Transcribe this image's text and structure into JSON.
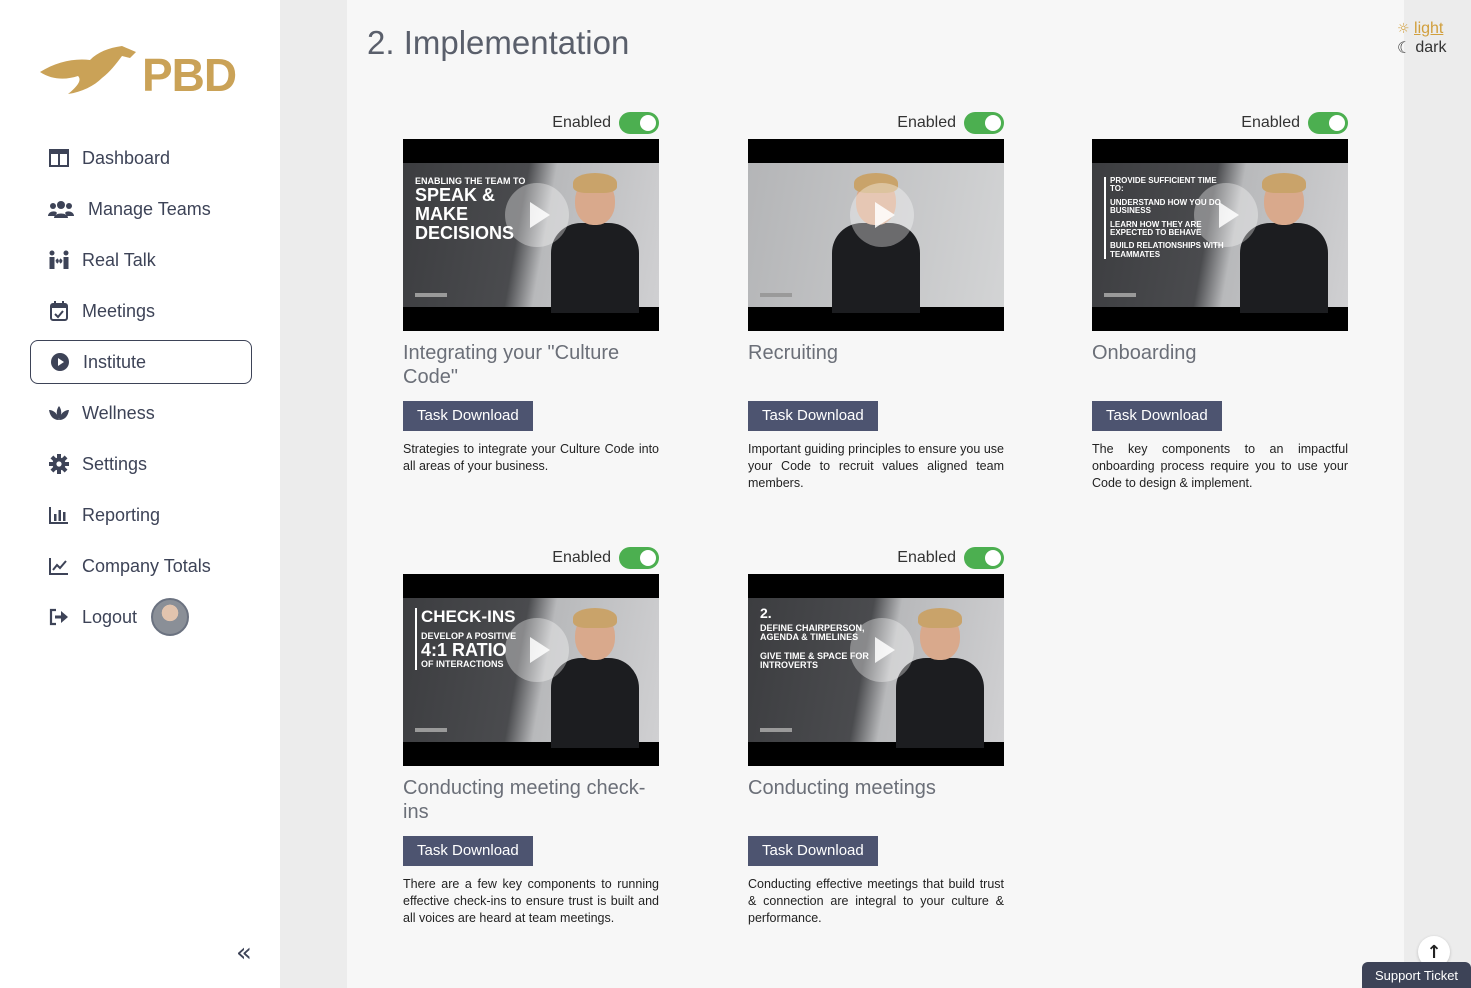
{
  "brand": {
    "name": "PBD",
    "color": "#caa257"
  },
  "sidebar": {
    "items": [
      {
        "label": "Dashboard",
        "icon": "columns-icon"
      },
      {
        "label": "Manage Teams",
        "icon": "users-icon"
      },
      {
        "label": "Real Talk",
        "icon": "people-arrows-icon"
      },
      {
        "label": "Meetings",
        "icon": "calendar-check-icon"
      },
      {
        "label": "Institute",
        "icon": "play-circle-icon",
        "active": true
      },
      {
        "label": "Wellness",
        "icon": "lotus-icon"
      },
      {
        "label": "Settings",
        "icon": "gear-icon"
      },
      {
        "label": "Reporting",
        "icon": "bar-chart-icon"
      },
      {
        "label": "Company Totals",
        "icon": "line-chart-icon"
      },
      {
        "label": "Logout",
        "icon": "logout-icon"
      }
    ],
    "collapse_glyph": "«"
  },
  "page": {
    "title": "2. Implementation"
  },
  "theme": {
    "light_label": "light",
    "dark_label": "dark"
  },
  "cards": [
    {
      "toggle_label": "Enabled",
      "title": "Integrating your \"Culture Code\"",
      "button": "Task Download",
      "desc": "Strategies to integrate your Culture Code into all areas of your business.",
      "frame_lines": [
        "ENABLING THE TEAM TO",
        "SPEAK &",
        "MAKE",
        "DECISIONS"
      ]
    },
    {
      "toggle_label": "Enabled",
      "title": "Recruiting",
      "button": "Task Download",
      "desc": "Important guiding principles to ensure you use your Code to recruit values aligned team members.",
      "frame_lines": []
    },
    {
      "toggle_label": "Enabled",
      "title": "Onboarding",
      "button": "Task Download",
      "desc": "The key components to an impactful onboarding process require you to use your Code to design & implement.",
      "frame_lines": [
        "PROVIDE SUFFICIENT TIME TO:",
        "UNDERSTAND HOW YOU DO BUSINESS",
        "LEARN HOW THEY ARE EXPECTED TO BEHAVE",
        "BUILD RELATIONSHIPS WITH TEAMMATES"
      ]
    },
    {
      "toggle_label": "Enabled",
      "title": "Conducting meeting check-ins",
      "button": "Task Download",
      "desc": "There are a few key components to running effective check-ins to ensure trust is built and all voices are heard at team meetings.",
      "frame_lines": [
        "CHECK-INS",
        "DEVELOP A POSITIVE",
        "4:1 RATIO",
        "OF INTERACTIONS"
      ]
    },
    {
      "toggle_label": "Enabled",
      "title": "Conducting meetings",
      "button": "Task Download",
      "desc": "Conducting effective meetings that build trust & connection are integral to your culture & performance.",
      "frame_lines": [
        "2.",
        "DEFINE CHAIRPERSON, AGENDA & TIMELINES",
        "GIVE TIME & SPACE FOR INTROVERTS"
      ]
    }
  ],
  "support": {
    "label": "Support Ticket"
  },
  "colors": {
    "toggle_on": "#4caf50",
    "button_bg": "#4d5470",
    "accent": "#d19f3c"
  }
}
